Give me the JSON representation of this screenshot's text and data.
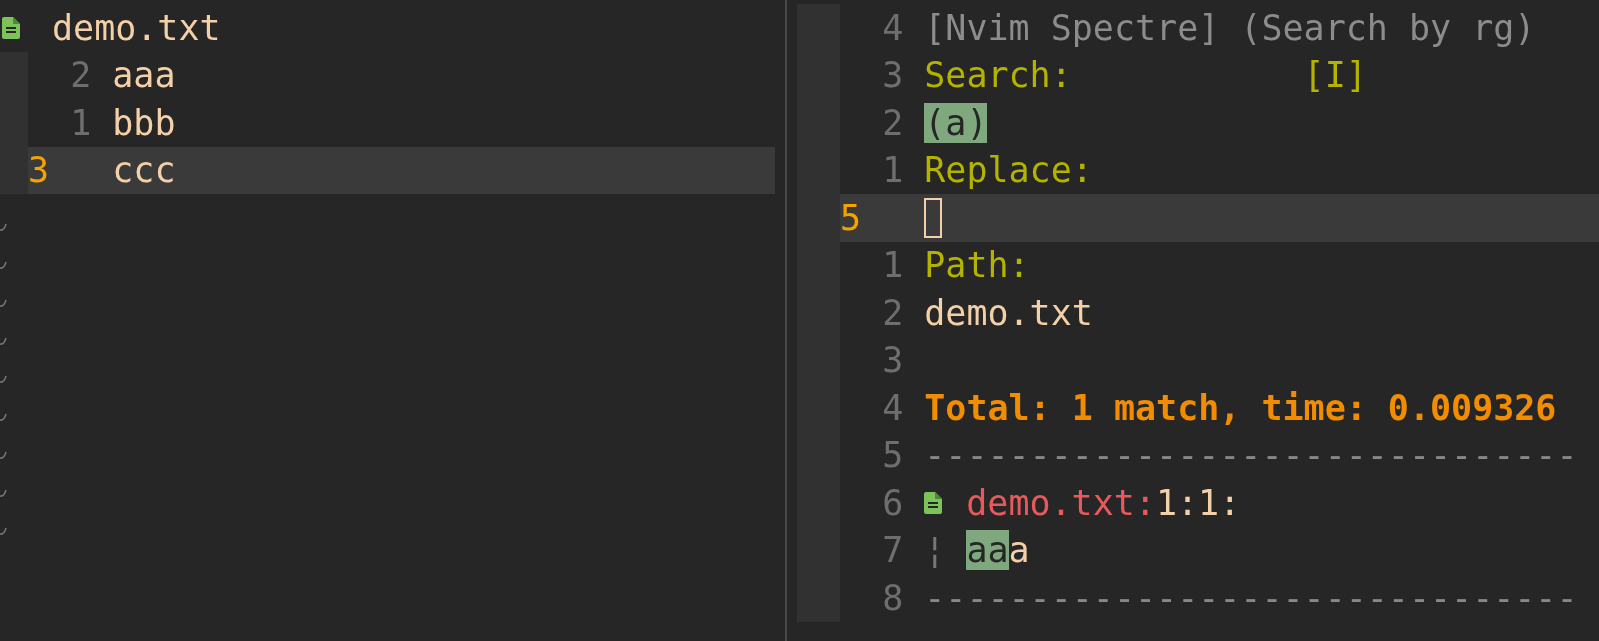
{
  "left_pane": {
    "file_header": {
      "name": "demo.txt"
    },
    "lines": [
      {
        "number": "2",
        "text": "aaa",
        "current": false
      },
      {
        "number": "1",
        "text": "bbb",
        "current": false
      },
      {
        "number": "3",
        "text": "ccc",
        "current": true
      }
    ]
  },
  "right_pane": {
    "lines": [
      {
        "number": "4",
        "kind": "title",
        "text": "[Nvim Spectre] (Search by rg)",
        "current": false
      },
      {
        "number": "3",
        "kind": "label",
        "text": "Search:",
        "mode": "[I]",
        "current": false
      },
      {
        "number": "2",
        "kind": "query",
        "text": "(a)",
        "current": false
      },
      {
        "number": "1",
        "kind": "label",
        "text": "Replace:",
        "current": false
      },
      {
        "number": "5",
        "kind": "cursor",
        "current": true
      },
      {
        "number": "1",
        "kind": "label",
        "text": "Path:",
        "current": false
      },
      {
        "number": "2",
        "kind": "text",
        "text": "demo.txt",
        "current": false
      },
      {
        "number": "3",
        "kind": "blank",
        "current": false
      },
      {
        "number": "4",
        "kind": "summary",
        "text": "Total: 1 match, time: 0.009326",
        "current": false
      },
      {
        "number": "5",
        "kind": "separator",
        "text": "-------------------------------",
        "current": false
      },
      {
        "number": "6",
        "kind": "file_result",
        "file": "demo.txt:",
        "position": "1:1:",
        "current": false
      },
      {
        "number": "7",
        "kind": "match",
        "guide": "¦",
        "match": "aa",
        "rest": "a",
        "current": false
      },
      {
        "number": "8",
        "kind": "separator",
        "text": "-------------------------------",
        "current": false
      }
    ]
  }
}
